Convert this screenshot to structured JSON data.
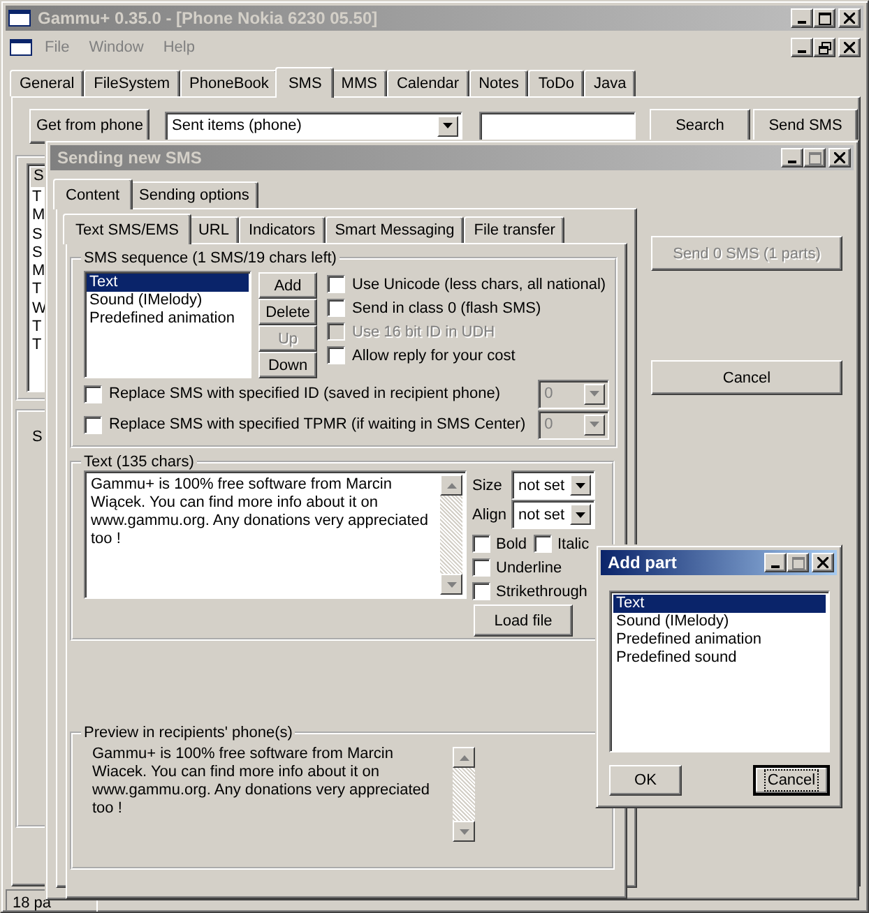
{
  "main_window": {
    "title": "Gammu+ 0.35.0 - [Phone Nokia 6230 05.50]",
    "menu": [
      "File",
      "Window",
      "Help"
    ],
    "tabs": [
      {
        "label": "General",
        "selected": false
      },
      {
        "label": "FileSystem",
        "selected": false
      },
      {
        "label": "PhoneBook",
        "selected": false
      },
      {
        "label": "SMS",
        "selected": true
      },
      {
        "label": "MMS",
        "selected": false
      },
      {
        "label": "Calendar",
        "selected": false
      },
      {
        "label": "Notes",
        "selected": false
      },
      {
        "label": "ToDo",
        "selected": false
      },
      {
        "label": "Java",
        "selected": false
      }
    ],
    "toolbar": {
      "get_button": "Get from phone",
      "folder": "Sent items (phone)",
      "search_button": "Search",
      "send_button": "Send SMS"
    },
    "message_list": {
      "header": "S",
      "rows": [
        "T",
        "M",
        "S",
        "S",
        "M",
        "T",
        "W",
        "T",
        "T"
      ]
    },
    "detail_panel": {
      "header": "S"
    },
    "status_bar": "18 pa"
  },
  "sending_dialog": {
    "title": "Sending new SMS",
    "tabs": [
      {
        "label": "Content",
        "selected": true
      },
      {
        "label": "Sending options",
        "selected": false
      }
    ],
    "subtabs": [
      {
        "label": "Text SMS/EMS",
        "selected": true
      },
      {
        "label": "URL",
        "selected": false
      },
      {
        "label": "Indicators",
        "selected": false
      },
      {
        "label": "Smart Messaging",
        "selected": false
      },
      {
        "label": "File transfer",
        "selected": false
      }
    ],
    "sequence": {
      "title": "SMS sequence (1 SMS/19 chars left)",
      "parts": [
        {
          "label": "Text",
          "selected": true
        },
        {
          "label": "Sound (IMelody)",
          "selected": false
        },
        {
          "label": "Predefined animation",
          "selected": false
        }
      ],
      "buttons": [
        {
          "label": "Add",
          "disabled": false
        },
        {
          "label": "Delete",
          "disabled": false
        },
        {
          "label": "Up",
          "disabled": true
        },
        {
          "label": "Down",
          "disabled": false
        }
      ],
      "options": [
        {
          "label": "Use Unicode (less chars, all national)",
          "checked": false,
          "disabled": false
        },
        {
          "label": "Send in class 0 (flash SMS)",
          "checked": false,
          "disabled": false
        },
        {
          "label": "Use 16 bit ID in UDH",
          "checked": false,
          "disabled": true
        },
        {
          "label": "Allow reply for your cost",
          "checked": false,
          "disabled": false
        }
      ],
      "replace": [
        {
          "label": "Replace SMS with specified ID (saved in recipient phone)",
          "checked": false,
          "value": "0",
          "disabled": true
        },
        {
          "label": "Replace SMS with specified TPMR (if waiting in SMS Center)",
          "checked": false,
          "value": "0",
          "disabled": true
        }
      ]
    },
    "text": {
      "title": "Text (135 chars)",
      "value": "Gammu+ is 100% free software from Marcin\nWiącek. You can find more info about it on\nwww.gammu.org. Any donations very appreciated\ntoo !",
      "size_label": "Size",
      "size": "not set",
      "align_label": "Align",
      "align": "not set",
      "styles": [
        {
          "label": "Bold",
          "checked": false
        },
        {
          "label": "Italic",
          "checked": false
        },
        {
          "label": "Underline",
          "checked": false
        },
        {
          "label": "Strikethrough",
          "checked": false
        }
      ],
      "load_button": "Load file"
    },
    "preview": {
      "title": "Preview in recipients' phone(s)",
      "value": "Gammu+ is 100% free software from Marcin\nWiacek. You can find more info about it on\nwww.gammu.org. Any donations very appreciated\ntoo !"
    },
    "send_button": {
      "label": "Send 0 SMS (1 parts)",
      "disabled": true
    },
    "cancel_button": "Cancel"
  },
  "add_part_dialog": {
    "title": "Add part",
    "items": [
      {
        "label": "Text",
        "selected": true
      },
      {
        "label": "Sound (IMelody)",
        "selected": false
      },
      {
        "label": "Predefined animation",
        "selected": false
      },
      {
        "label": "Predefined sound",
        "selected": false
      }
    ],
    "ok_button": "OK",
    "cancel_button": {
      "label": "Cancel",
      "default": true
    }
  }
}
